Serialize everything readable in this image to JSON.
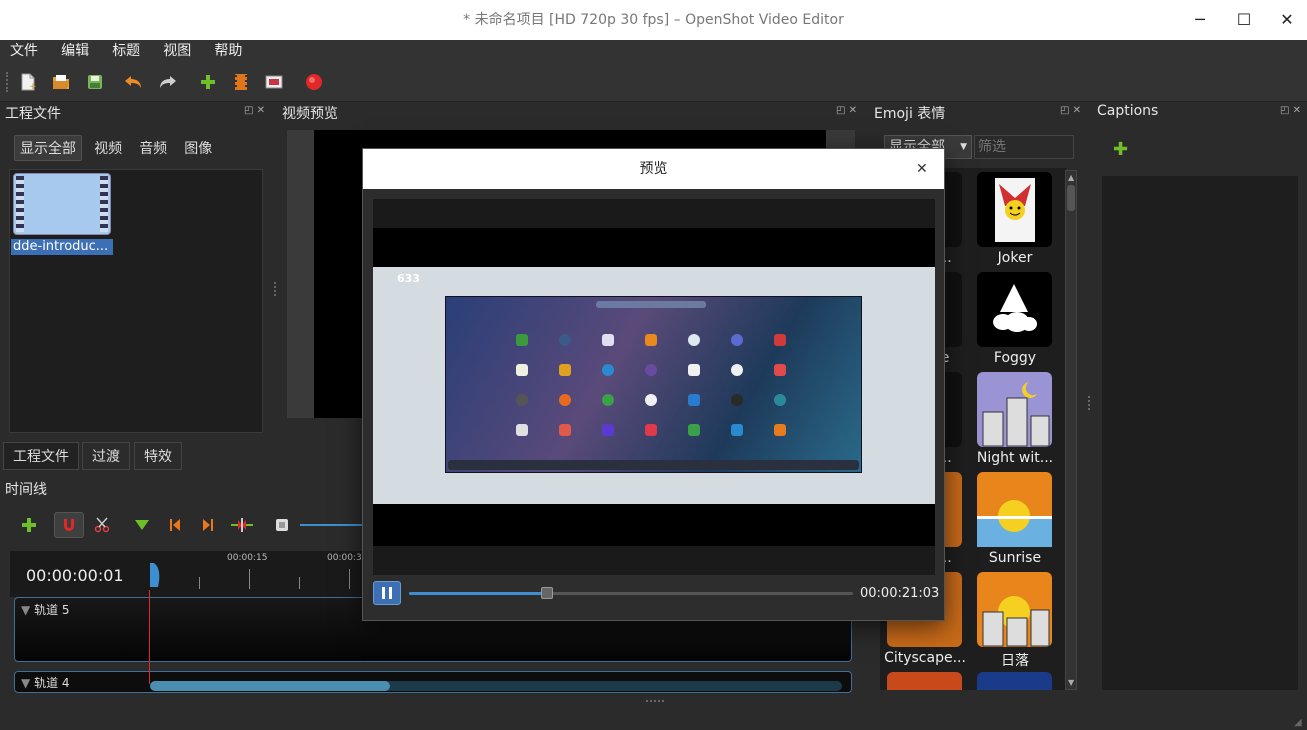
{
  "window": {
    "title": "* 未命名项目 [HD 720p 30 fps] – OpenShot Video Editor",
    "min": "─",
    "max": "☐",
    "close": "✕"
  },
  "menu": [
    "文件",
    "编辑",
    "标题",
    "视图",
    "帮助"
  ],
  "toolbar": {
    "icons": [
      "new-project-icon",
      "open-project-icon",
      "save-project-icon",
      "undo-icon",
      "redo-icon",
      "import-files-icon",
      "profile-icon",
      "fullscreen-icon",
      "export-icon"
    ]
  },
  "project_files": {
    "title": "工程文件",
    "filters": [
      "显示全部",
      "视频",
      "音频",
      "图像"
    ],
    "file_name": "dde-introduc..."
  },
  "video_preview": {
    "title": "视频预览"
  },
  "bottom_tabs": [
    "工程文件",
    "过渡",
    "特效"
  ],
  "timeline": {
    "title": "时间线",
    "timecode": "00:00:00:01",
    "tick_labels": [
      "00:00:15",
      "00:00:30"
    ],
    "tracks": [
      "轨道 5",
      "轨道 4"
    ]
  },
  "emoji": {
    "title": "Emoji 表情",
    "filter_selected": "显示全部",
    "filter_placeholder": "筛选",
    "items": [
      {
        "label": "Joker"
      },
      {
        "label": "Foggy"
      },
      {
        "label": "Night wit..."
      },
      {
        "label": "Sunrise"
      },
      {
        "label": "日落"
      }
    ],
    "left_labels": [
      "...",
      "e",
      "...",
      "...",
      "Cityscape..."
    ]
  },
  "captions": {
    "title": "Captions",
    "add_icon": "✚"
  },
  "preview_dialog": {
    "title": "预览",
    "close": "✕",
    "time": "00:00:21:03",
    "frame_number": "633",
    "progress_fraction": 0.31
  },
  "colors": {
    "accent": "#3d8fd1",
    "add_green": "#6fbf2a",
    "record_red": "#e02828"
  }
}
